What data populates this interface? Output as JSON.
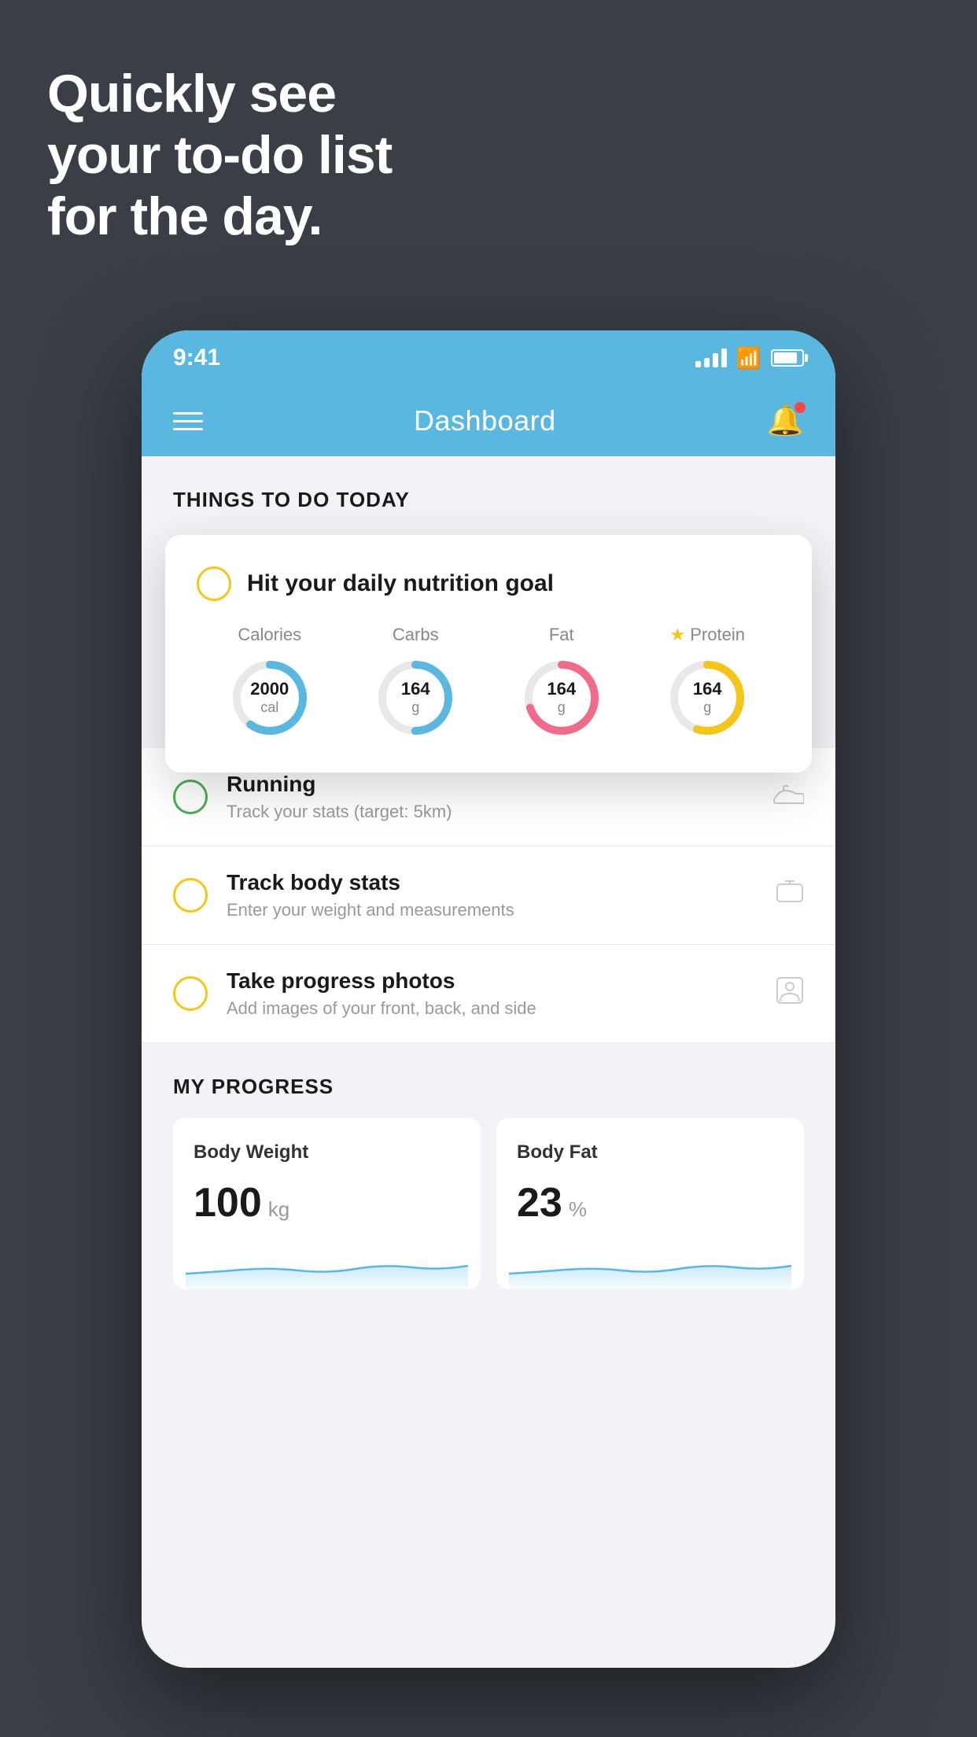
{
  "hero": {
    "line1": "Quickly see",
    "line2": "your to-do list",
    "line3": "for the day."
  },
  "status_bar": {
    "time": "9:41"
  },
  "header": {
    "title": "Dashboard"
  },
  "things_section": {
    "label": "THINGS TO DO TODAY"
  },
  "floating_card": {
    "title": "Hit your daily nutrition goal",
    "items": [
      {
        "label": "Calories",
        "value": "2000",
        "unit": "cal",
        "color": "#5ab8e0",
        "percent": 60
      },
      {
        "label": "Carbs",
        "value": "164",
        "unit": "g",
        "color": "#5ab8e0",
        "percent": 50
      },
      {
        "label": "Fat",
        "value": "164",
        "unit": "g",
        "color": "#f06b8a",
        "percent": 70
      },
      {
        "label": "Protein",
        "value": "164",
        "unit": "g",
        "color": "#f5c518",
        "percent": 55,
        "star": true
      }
    ]
  },
  "list_items": [
    {
      "title": "Running",
      "sub": "Track your stats (target: 5km)",
      "check_color": "green",
      "icon": "shoe"
    },
    {
      "title": "Track body stats",
      "sub": "Enter your weight and measurements",
      "check_color": "yellow",
      "icon": "scale"
    },
    {
      "title": "Take progress photos",
      "sub": "Add images of your front, back, and side",
      "check_color": "yellow",
      "icon": "person"
    }
  ],
  "progress": {
    "label": "MY PROGRESS",
    "cards": [
      {
        "title": "Body Weight",
        "value": "100",
        "unit": "kg"
      },
      {
        "title": "Body Fat",
        "value": "23",
        "unit": "%"
      }
    ]
  }
}
